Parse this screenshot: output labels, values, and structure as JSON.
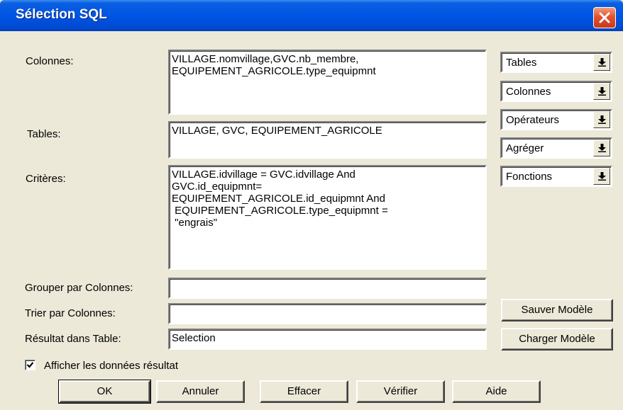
{
  "window": {
    "title": "Sélection SQL"
  },
  "labels": {
    "colonnes": "Colonnes:",
    "tables": "Tables:",
    "criteres": "Critères:",
    "grouper": "Grouper par Colonnes:",
    "trier": "Trier par Colonnes:",
    "resultat": "Résultat dans Table:"
  },
  "fields": {
    "colonnes": "VILLAGE.nomvillage,GVC.nb_membre,\nEQUIPEMENT_AGRICOLE.type_equipmnt",
    "tables": "VILLAGE, GVC, EQUIPEMENT_AGRICOLE",
    "criteres": "VILLAGE.idvillage = GVC.idvillage And\nGVC.id_equipmnt=\nEQUIPEMENT_AGRICOLE.id_equipmnt And\n EQUIPEMENT_AGRICOLE.type_equipmnt =\n \"engrais\"",
    "grouper": "",
    "trier": "",
    "resultat": "Selection"
  },
  "combos": {
    "tables": "Tables",
    "colonnes": "Colonnes",
    "operateurs": "Opérateurs",
    "agreger": "Agréger",
    "fonctions": "Fonctions"
  },
  "side_buttons": {
    "sauver": "Sauver Modèle",
    "charger": "Charger Modèle"
  },
  "checkbox": {
    "label": "Afficher les données résultat",
    "checked": true
  },
  "buttons": {
    "ok": "OK",
    "annuler": "Annuler",
    "effacer": "Effacer",
    "verifier": "Vérifier",
    "aide": "Aide"
  },
  "icons": {
    "close": "close-icon",
    "dropdown": "dropdown-arrow-icon",
    "check": "checkmark-icon"
  }
}
